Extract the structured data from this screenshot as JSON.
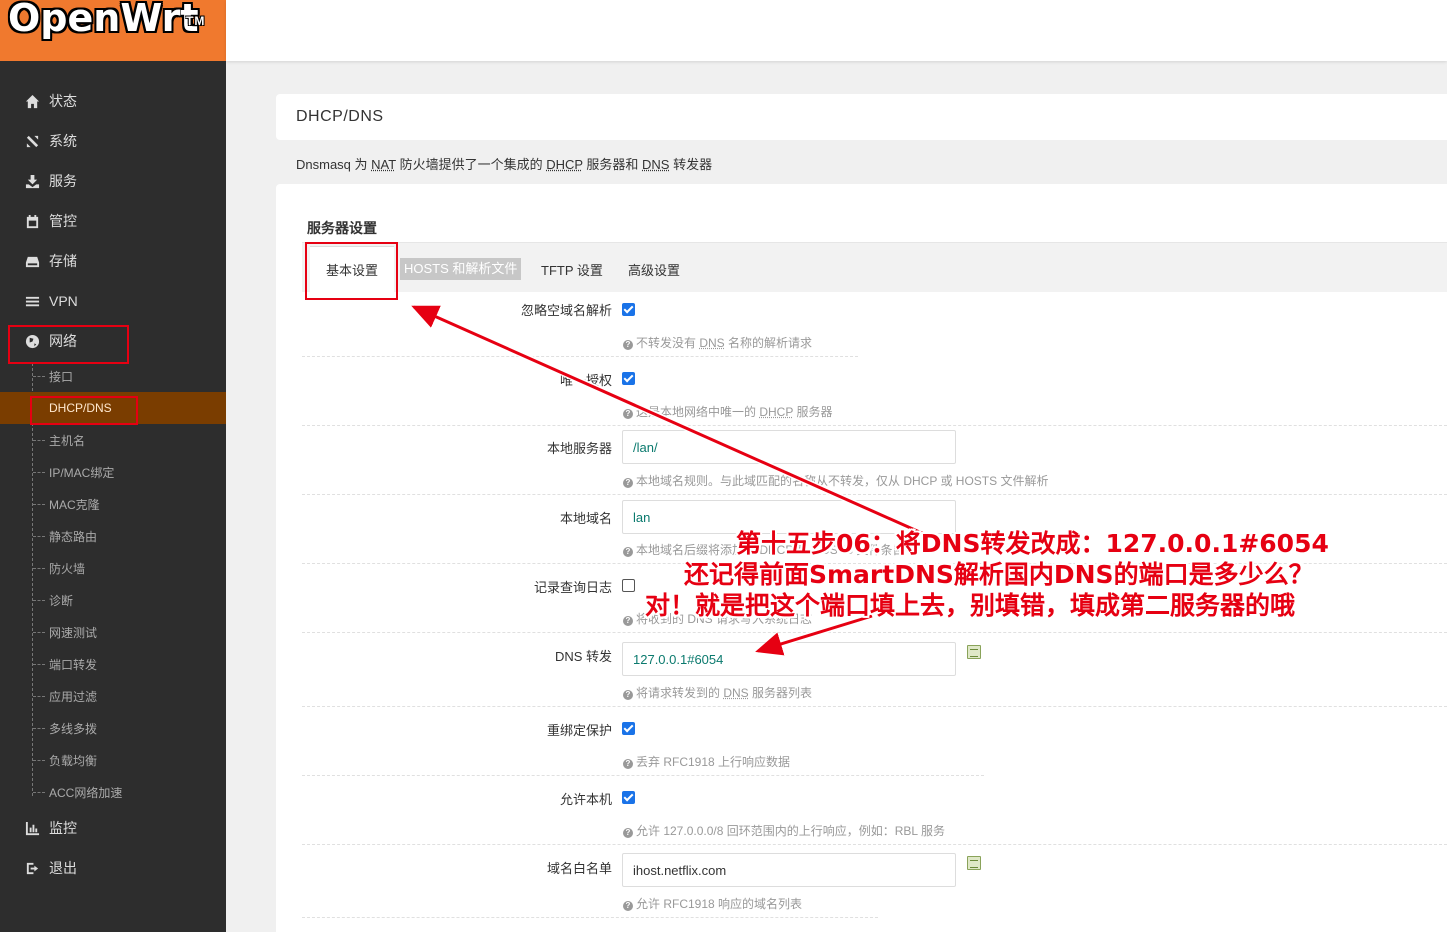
{
  "brand": {
    "logo": "OpenWrt",
    "tm": "TM"
  },
  "sidebar": {
    "items": [
      {
        "label": "状态",
        "icon": "home-icon"
      },
      {
        "label": "系统",
        "icon": "tools-icon"
      },
      {
        "label": "服务",
        "icon": "download-icon"
      },
      {
        "label": "管控",
        "icon": "calendar-icon"
      },
      {
        "label": "存储",
        "icon": "drive-icon"
      },
      {
        "label": "VPN",
        "icon": "bars-icon"
      },
      {
        "label": "网络",
        "icon": "globe-icon"
      },
      {
        "label": "监控",
        "icon": "chart-icon"
      },
      {
        "label": "退出",
        "icon": "logout-icon"
      }
    ],
    "network_sub": [
      "接口",
      "DHCP/DNS",
      "主机名",
      "IP/MAC绑定",
      "MAC克隆",
      "静态路由",
      "防火墙",
      "诊断",
      "网速测试",
      "端口转发",
      "应用过滤",
      "多线多拨",
      "负载均衡",
      "ACC网络加速"
    ]
  },
  "page": {
    "title": "DHCP/DNS",
    "desc_parts": [
      "Dnsmasq 为 ",
      "NAT",
      " 防火墙提供了一个集成的 ",
      "DHCP",
      " 服务器和 ",
      "DNS",
      " 转发器"
    ],
    "section": "服务器设置",
    "tabs": [
      "基本设置",
      "HOSTS 和解析文件",
      "TFTP 设置",
      "高级设置"
    ]
  },
  "form": {
    "ignore_empty": {
      "label": "忽略空域名解析",
      "checked": true,
      "help_parts": [
        "不转发没有 ",
        "DNS",
        " 名称的解析请求"
      ]
    },
    "authoritative": {
      "label": "唯一授权",
      "checked": true,
      "help_parts": [
        "这是本地网络中唯一的 ",
        "DHCP",
        " 服务器"
      ]
    },
    "local_server": {
      "label": "本地服务器",
      "value": "/lan/",
      "help": "本地域名规则。与此域匹配的名称从不转发，仅从 DHCP 或 HOSTS 文件解析"
    },
    "local_domain": {
      "label": "本地域名",
      "value": "lan",
      "help": "本地域名后缀将添加到 DHCP 和 HOSTS 文件条目"
    },
    "log_queries": {
      "label": "记录查询日志",
      "checked": false,
      "help": "将收到的 DNS 请求写入系统日志"
    },
    "dns_forward": {
      "label": "DNS 转发",
      "value": "127.0.0.1#6054",
      "help_parts": [
        "将请求转发到的 ",
        "DNS",
        " 服务器列表"
      ]
    },
    "rebind_protection": {
      "label": "重绑定保护",
      "checked": true,
      "help": "丢弃 RFC1918 上行响应数据"
    },
    "allow_localhost": {
      "label": "允许本机",
      "checked": true,
      "help": "允许 127.0.0.0/8 回环范围内的上行响应，例如：RBL 服务"
    },
    "domain_whitelist": {
      "label": "域名白名单",
      "value": "ihost.netflix.com",
      "help": "允许 RFC1918 响应的域名列表"
    }
  },
  "annotation": {
    "line1": "第十五步06：将DNS转发改成：127.0.0.1#6054",
    "line2": "还记得前面SmartDNS解析国内DNS的端口是多少么？",
    "line3": "对！就是把这个端口填上去，别填错，填成第二服务器的哦",
    "color": "#e60012"
  },
  "colors": {
    "accent": "#f0792e",
    "sidebar": "#2d2d2d",
    "active_sub": "#7a3d00",
    "checkbox": "#1a73e8"
  }
}
